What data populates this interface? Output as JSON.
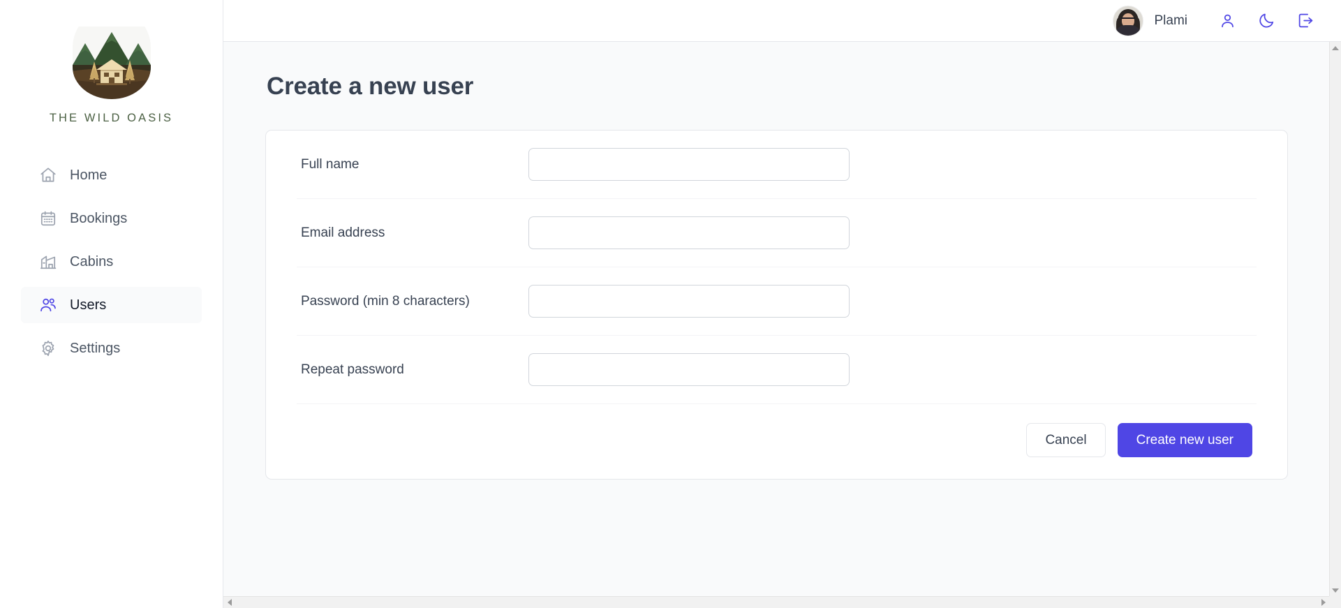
{
  "brand": {
    "name": "THE WILD OASIS",
    "logo_icon": "mountain-cabin-logo",
    "logo_colors": {
      "mountain_dark": "#2f4a33",
      "mountain_mid": "#3f6140",
      "forest": "#3b2f1e",
      "ground": "#4a3621",
      "cabin": "#e8d5a8",
      "tree": "#d9b874"
    }
  },
  "sidebar": {
    "items": [
      {
        "label": "Home",
        "icon": "home-icon",
        "active": false
      },
      {
        "label": "Bookings",
        "icon": "calendar-icon",
        "active": false
      },
      {
        "label": "Cabins",
        "icon": "cabin-icon",
        "active": false
      },
      {
        "label": "Users",
        "icon": "users-icon",
        "active": true
      },
      {
        "label": "Settings",
        "icon": "gear-icon",
        "active": false
      }
    ]
  },
  "header": {
    "user_name": "Plami",
    "avatar_alt": "user-avatar",
    "actions": [
      {
        "icon": "user-icon",
        "title": "Account"
      },
      {
        "icon": "moon-icon",
        "title": "Toggle dark mode"
      },
      {
        "icon": "logout-icon",
        "title": "Logout"
      }
    ]
  },
  "main": {
    "page_title": "Create a new user",
    "form": {
      "fields": [
        {
          "label": "Full name",
          "value": "",
          "placeholder": "",
          "type": "text",
          "name": "fullName"
        },
        {
          "label": "Email address",
          "value": "",
          "placeholder": "",
          "type": "email",
          "name": "email"
        },
        {
          "label": "Password (min 8 characters)",
          "value": "",
          "placeholder": "",
          "type": "password",
          "name": "password"
        },
        {
          "label": "Repeat password",
          "value": "",
          "placeholder": "",
          "type": "password",
          "name": "passwordConfirm"
        }
      ],
      "cancel_label": "Cancel",
      "submit_label": "Create new user"
    }
  },
  "colors": {
    "accent": "#4f46e5",
    "page_bg": "#f9fafb",
    "card_bg": "#ffffff",
    "text": "#374151",
    "muted_icon": "#9ca3af",
    "border": "#e5e7eb",
    "brand_green": "#4b6043"
  },
  "scrollbars": {
    "vertical": {
      "up": "scroll-up-arrow",
      "down": "scroll-down-arrow"
    },
    "horizontal": {
      "left": "scroll-left-arrow",
      "right": "scroll-right-arrow"
    }
  }
}
